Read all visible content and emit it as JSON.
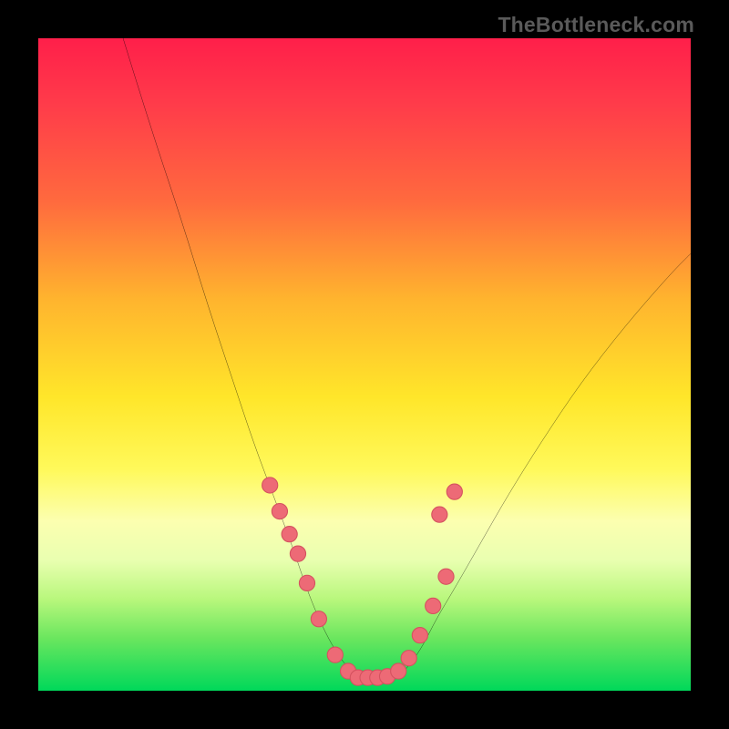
{
  "attribution": "TheBottleneck.com",
  "colors": {
    "frame": "#000000",
    "curve": "#000000",
    "marker_fill": "#ed6a76",
    "marker_stroke": "#d4525f",
    "gradient_stops": [
      "#ff1f4a",
      "#ff3b4a",
      "#ff6a3e",
      "#ffb42e",
      "#ffe62a",
      "#fff95a",
      "#fcffb0",
      "#e9ffb0",
      "#b8f77c",
      "#6ae65e",
      "#00d85a"
    ]
  },
  "chart_data": {
    "type": "line",
    "title": "",
    "xlabel": "",
    "ylabel": "",
    "xlim": [
      0,
      100
    ],
    "ylim": [
      0,
      100
    ],
    "grid": false,
    "legend": null,
    "note": "Axes are unlabeled in the image; x and y values are estimated as percentage of the plot area (x left→right, y bottom→top).",
    "series": [
      {
        "name": "curve",
        "x": [
          13,
          17,
          22,
          26,
          30,
          33,
          36,
          39,
          41,
          43,
          45,
          47,
          49,
          52,
          55,
          57,
          59,
          61,
          64,
          68,
          72,
          77,
          83,
          90,
          97,
          100
        ],
        "y": [
          100,
          87,
          72,
          59,
          47,
          38,
          30,
          22,
          16,
          11,
          7,
          4,
          2,
          2,
          2,
          4,
          7,
          11,
          16,
          23,
          30,
          38,
          47,
          56,
          64,
          67
        ]
      }
    ],
    "markers": {
      "name": "highlighted-points",
      "style": "circle",
      "radius_pct": 1.2,
      "x": [
        35.5,
        37,
        38.5,
        39.8,
        41.2,
        43.0,
        45.5,
        47.5,
        49.0,
        50.5,
        52.0,
        53.5,
        55.2,
        56.8,
        58.5,
        60.5,
        62.5,
        61.5,
        63.8
      ],
      "y": [
        31.5,
        27.5,
        24.0,
        21.0,
        16.5,
        11.0,
        5.5,
        3.0,
        2.0,
        2.0,
        2.0,
        2.2,
        3.0,
        5.0,
        8.5,
        13.0,
        17.5,
        27.0,
        30.5
      ]
    }
  }
}
